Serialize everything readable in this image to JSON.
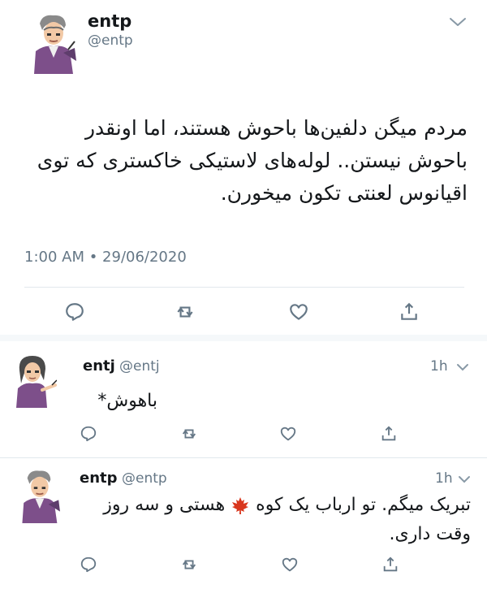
{
  "main_tweet": {
    "author_name": "entp",
    "author_handle": "@entp",
    "text": "مردم میگن دلفین‌ها باحوش هستند، اما اونقدر باحوش نیستن.. لوله‌های لاستیکی خاکستری که توی اقیانوس لعنتی تکون میخورن.",
    "timestamp": "1:00 AM • 29/06/2020",
    "avatar_icon": "gray-haired-man-avatar-icon",
    "actions": [
      "reply-icon",
      "retweet-icon",
      "like-icon",
      "share-icon"
    ]
  },
  "replies": [
    {
      "author_name": "entj",
      "author_handle": "@entj",
      "time": "1h",
      "text": "باهوش*",
      "avatar_icon": "woman-pointing-avatar-icon"
    },
    {
      "author_name": "entp",
      "author_handle": "@entp",
      "time": "1h",
      "text_before_emoji": "تبریک میگم. تو ارباب یک کوه ",
      "text_after_emoji": " هستی و سه روز وقت داری.",
      "emoji_icon": "maple-leaf-icon",
      "avatar_icon": "gray-haired-man-avatar-icon"
    }
  ],
  "colors": {
    "text": "#14171a",
    "secondary": "#657786",
    "divider": "#e1e8ed",
    "maple": "#d9371e"
  }
}
